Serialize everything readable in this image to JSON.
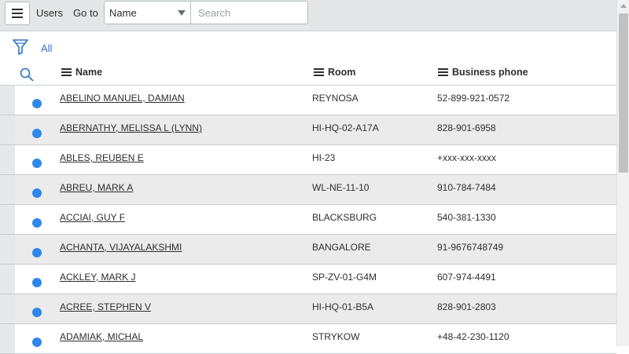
{
  "header": {
    "title": "Users",
    "goto_label": "Go to",
    "field_select_value": "Name",
    "search_placeholder": "Search"
  },
  "filter": {
    "label": "All"
  },
  "columns": {
    "name": "Name",
    "room": "Room",
    "phone": "Business phone"
  },
  "rows": [
    {
      "name": "ABELINO MANUEL, DAMIAN",
      "room": "REYNOSA",
      "phone": "52-899-921-0572"
    },
    {
      "name": "ABERNATHY, MELISSA L (LYNN)",
      "room": "HI-HQ-02-A17A",
      "phone": "828-901-6958"
    },
    {
      "name": "ABLES, REUBEN E",
      "room": "HI-23",
      "phone": "+xxx-xxx-xxxx"
    },
    {
      "name": "ABREU, MARK A",
      "room": "WL-NE-11-10",
      "phone": "910-784-7484"
    },
    {
      "name": "ACCIAI, GUY F",
      "room": "BLACKSBURG",
      "phone": "540-381-1330"
    },
    {
      "name": "ACHANTA, VIJAYALAKSHMI",
      "room": "BANGALORE",
      "phone": "91-9676748749"
    },
    {
      "name": "ACKLEY, MARK J",
      "room": "SP-ZV-01-G4M",
      "phone": "607-974-4491"
    },
    {
      "name": "ACREE, STEPHEN V",
      "room": "HI-HQ-01-B5A",
      "phone": "828-901-2803"
    },
    {
      "name": "ADAMIAK, MICHAL",
      "room": "STRYKOW",
      "phone": "+48-42-230-1120"
    }
  ],
  "colors": {
    "accent": "#2a73c6",
    "status_dot": "#2f86eb"
  },
  "icons": {
    "menu": "hamburger-menu-icon",
    "caret": "caret-down-icon",
    "filter": "funnel-filter-icon",
    "search": "magnifier-search-icon",
    "column_menu": "column-menu-icon"
  }
}
